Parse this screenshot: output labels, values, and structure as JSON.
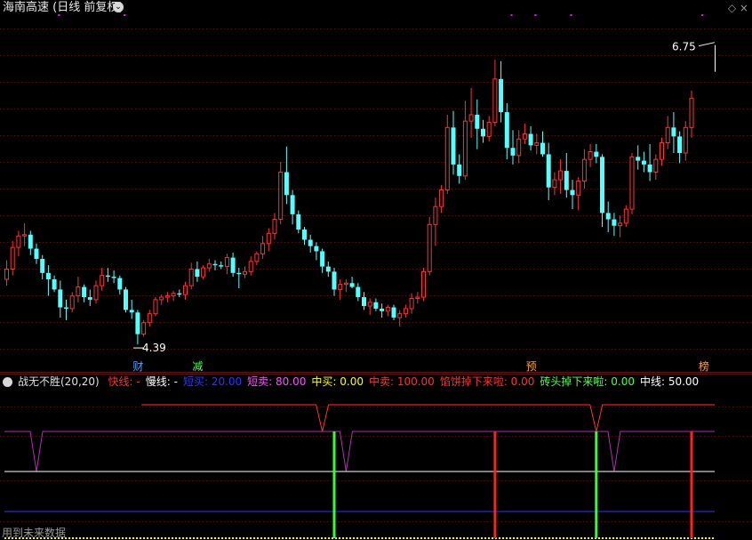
{
  "header": {
    "title": "海南高速 (日线 前复权)",
    "window_controls": "◇ ×"
  },
  "chart_data": [
    {
      "type": "candlestick",
      "title": "海南高速 (日线 前复权)",
      "colors": {
        "up": "#ff3232",
        "down": "#54ffff",
        "flat": "#ffffff",
        "grid": "#7a0000",
        "background": "#000000"
      },
      "ylim": [
        4.3,
        6.95
      ],
      "grid": true,
      "annotations": [
        {
          "text": "6.75",
          "price": 6.75,
          "kind": "high-marker"
        },
        {
          "text": "4.39",
          "price": 4.39,
          "kind": "low-marker"
        }
      ],
      "event_labels": [
        {
          "text": "财",
          "index": 22,
          "color": "#54a0ff"
        },
        {
          "text": "减",
          "index": 32,
          "color": "#50ff50"
        },
        {
          "text": "预",
          "index": 88,
          "color": "#ffa040"
        },
        {
          "text": "榜",
          "index": 117,
          "color": "#ffa040"
        }
      ],
      "top_markers": [
        {
          "index": 9
        },
        {
          "index": 20
        },
        {
          "index": 85
        },
        {
          "index": 89
        },
        {
          "index": 95
        },
        {
          "index": 117
        }
      ],
      "candles": [
        [
          4.9,
          5.05,
          4.85,
          4.98
        ],
        [
          4.98,
          5.2,
          4.93,
          5.15
        ],
        [
          5.15,
          5.28,
          5.08,
          5.24
        ],
        [
          5.24,
          5.34,
          5.16,
          5.25
        ],
        [
          5.25,
          5.28,
          5.09,
          5.14
        ],
        [
          5.14,
          5.18,
          5.02,
          5.06
        ],
        [
          5.06,
          5.09,
          4.9,
          4.95
        ],
        [
          4.95,
          5.01,
          4.77,
          4.9
        ],
        [
          4.9,
          4.93,
          4.8,
          4.82
        ],
        [
          4.82,
          4.89,
          4.6,
          4.68
        ],
        [
          4.68,
          4.74,
          4.58,
          4.67
        ],
        [
          4.67,
          4.8,
          4.64,
          4.77
        ],
        [
          4.77,
          4.92,
          4.72,
          4.84
        ],
        [
          4.84,
          4.86,
          4.72,
          4.76
        ],
        [
          4.76,
          4.82,
          4.69,
          4.74
        ],
        [
          4.74,
          4.89,
          4.71,
          4.85
        ],
        [
          4.85,
          4.99,
          4.81,
          4.93
        ],
        [
          4.93,
          4.99,
          4.88,
          4.92
        ],
        [
          4.92,
          4.97,
          4.87,
          4.91
        ],
        [
          4.91,
          4.93,
          4.78,
          4.82
        ],
        [
          4.82,
          4.84,
          4.64,
          4.66
        ],
        [
          4.66,
          4.74,
          4.59,
          4.64
        ],
        [
          4.64,
          4.66,
          4.39,
          4.47
        ],
        [
          4.47,
          4.58,
          4.45,
          4.56
        ],
        [
          4.56,
          4.66,
          4.53,
          4.63
        ],
        [
          4.63,
          4.76,
          4.61,
          4.74
        ],
        [
          4.74,
          4.78,
          4.7,
          4.76
        ],
        [
          4.76,
          4.8,
          4.72,
          4.77
        ],
        [
          4.77,
          4.81,
          4.73,
          4.79
        ],
        [
          4.79,
          4.82,
          4.76,
          4.78
        ],
        [
          4.78,
          4.88,
          4.74,
          4.85
        ],
        [
          4.85,
          5.03,
          4.82,
          4.98
        ],
        [
          4.98,
          5.04,
          4.88,
          4.92
        ],
        [
          4.92,
          5.01,
          4.9,
          4.99
        ],
        [
          4.99,
          5.06,
          4.96,
          5.02
        ],
        [
          5.02,
          5.05,
          4.97,
          5.01
        ],
        [
          5.01,
          5.04,
          4.98,
          5.0
        ],
        [
          5.0,
          5.1,
          4.94,
          5.07
        ],
        [
          5.07,
          5.11,
          4.92,
          4.95
        ],
        [
          4.95,
          4.99,
          4.83,
          4.94
        ],
        [
          4.94,
          5.0,
          4.91,
          4.96
        ],
        [
          4.96,
          5.08,
          4.93,
          5.04
        ],
        [
          5.04,
          5.12,
          5.01,
          5.1
        ],
        [
          5.1,
          5.24,
          5.06,
          5.18
        ],
        [
          5.18,
          5.3,
          5.12,
          5.26
        ],
        [
          5.26,
          5.42,
          5.21,
          5.37
        ],
        [
          5.37,
          5.82,
          5.33,
          5.74
        ],
        [
          5.74,
          5.94,
          5.49,
          5.56
        ],
        [
          5.56,
          5.6,
          5.33,
          5.41
        ],
        [
          5.41,
          5.44,
          5.26,
          5.29
        ],
        [
          5.29,
          5.31,
          5.17,
          5.21
        ],
        [
          5.21,
          5.25,
          5.11,
          5.16
        ],
        [
          5.16,
          5.19,
          5.05,
          5.12
        ],
        [
          5.12,
          5.14,
          4.95,
          5.0
        ],
        [
          5.0,
          5.04,
          4.92,
          4.96
        ],
        [
          4.96,
          4.99,
          4.77,
          4.82
        ],
        [
          4.82,
          4.9,
          4.74,
          4.86
        ],
        [
          4.86,
          4.9,
          4.8,
          4.87
        ],
        [
          4.87,
          4.92,
          4.83,
          4.84
        ],
        [
          4.84,
          4.87,
          4.73,
          4.76
        ],
        [
          4.76,
          4.8,
          4.66,
          4.69
        ],
        [
          4.69,
          4.75,
          4.62,
          4.72
        ],
        [
          4.72,
          4.75,
          4.65,
          4.67
        ],
        [
          4.67,
          4.71,
          4.6,
          4.65
        ],
        [
          4.65,
          4.7,
          4.61,
          4.68
        ],
        [
          4.68,
          4.7,
          4.58,
          4.6
        ],
        [
          4.6,
          4.66,
          4.53,
          4.63
        ],
        [
          4.63,
          4.7,
          4.6,
          4.67
        ],
        [
          4.67,
          4.79,
          4.63,
          4.75
        ],
        [
          4.75,
          4.8,
          4.71,
          4.76
        ],
        [
          4.76,
          4.99,
          4.73,
          4.96
        ],
        [
          4.96,
          5.39,
          4.93,
          5.33
        ],
        [
          5.33,
          5.54,
          5.16,
          5.47
        ],
        [
          5.47,
          5.64,
          5.42,
          5.6
        ],
        [
          5.6,
          6.19,
          5.57,
          6.09
        ],
        [
          6.09,
          6.22,
          5.72,
          5.8
        ],
        [
          5.8,
          5.88,
          5.65,
          5.71
        ],
        [
          5.71,
          6.3,
          5.68,
          6.14
        ],
        [
          6.14,
          6.4,
          6.01,
          6.19
        ],
        [
          6.19,
          6.31,
          5.92,
          6.08
        ],
        [
          6.08,
          6.15,
          5.97,
          6.02
        ],
        [
          6.02,
          6.18,
          5.98,
          6.13
        ],
        [
          6.13,
          6.62,
          6.1,
          6.47
        ],
        [
          6.47,
          6.61,
          6.13,
          6.21
        ],
        [
          6.21,
          6.28,
          5.84,
          5.93
        ],
        [
          5.93,
          6.07,
          5.8,
          5.87
        ],
        [
          5.87,
          6.07,
          5.81,
          6.0
        ],
        [
          6.0,
          6.12,
          5.96,
          6.04
        ],
        [
          6.04,
          6.1,
          5.91,
          5.95
        ],
        [
          5.95,
          6.04,
          5.88,
          5.97
        ],
        [
          5.97,
          6.06,
          5.86,
          5.88
        ],
        [
          5.88,
          5.97,
          5.52,
          5.62
        ],
        [
          5.62,
          5.74,
          5.56,
          5.68
        ],
        [
          5.68,
          5.84,
          5.57,
          5.75
        ],
        [
          5.75,
          5.89,
          5.54,
          5.6
        ],
        [
          5.6,
          5.68,
          5.45,
          5.56
        ],
        [
          5.56,
          5.7,
          5.44,
          5.67
        ],
        [
          5.67,
          5.92,
          5.61,
          5.84
        ],
        [
          5.84,
          5.96,
          5.78,
          5.9
        ],
        [
          5.9,
          5.96,
          5.81,
          5.86
        ],
        [
          5.86,
          5.88,
          5.31,
          5.42
        ],
        [
          5.42,
          5.51,
          5.27,
          5.37
        ],
        [
          5.37,
          5.42,
          5.24,
          5.32
        ],
        [
          5.32,
          5.4,
          5.23,
          5.34
        ],
        [
          5.34,
          5.48,
          5.31,
          5.45
        ],
        [
          5.45,
          5.89,
          5.41,
          5.86
        ],
        [
          5.86,
          5.95,
          5.76,
          5.83
        ],
        [
          5.83,
          5.9,
          5.74,
          5.8
        ],
        [
          5.8,
          5.96,
          5.67,
          5.74
        ],
        [
          5.74,
          5.88,
          5.68,
          5.84
        ],
        [
          5.84,
          6.01,
          5.79,
          5.97
        ],
        [
          5.97,
          6.18,
          5.92,
          6.09
        ],
        [
          6.09,
          6.21,
          5.89,
          6.02
        ],
        [
          6.02,
          6.06,
          5.81,
          5.89
        ],
        [
          5.89,
          6.14,
          5.83,
          6.09
        ],
        [
          6.09,
          6.38,
          6.01,
          6.32
        ]
      ]
    },
    {
      "type": "line",
      "title": "战无不胜(20,20)",
      "ylim": [
        0,
        110
      ],
      "legend": [
        {
          "label": "快线: -",
          "color": "#ff3232"
        },
        {
          "label": "慢线: -",
          "color": "#ffffff"
        },
        {
          "label": "短买: 20.00",
          "color": "#3232ff"
        },
        {
          "label": "短卖: 80.00",
          "color": "#ff50ff"
        },
        {
          "label": "中买: 0.00",
          "color": "#ffff00"
        },
        {
          "label": "中卖: 100.00",
          "color": "#ff3232"
        },
        {
          "label": "馅饼掉下来啦: 0.00",
          "color": "#ff3232"
        },
        {
          "label": "砖头掉下来啦: 0.00",
          "color": "#50ff50"
        },
        {
          "label": "中线: 50.00",
          "color": "#ffffff"
        }
      ],
      "horizontal_lines": [
        {
          "name": "中卖",
          "value": 100,
          "color": "#ff3232",
          "segment_start_index": 23
        },
        {
          "name": "短卖",
          "value": 80,
          "color": "#b030b0"
        },
        {
          "name": "中线",
          "value": 50,
          "color": "#ffffff"
        },
        {
          "name": "短买",
          "value": 20,
          "color": "#3232ff"
        },
        {
          "name": "中买",
          "value": 0,
          "color": "#ffff00",
          "style": "dotted"
        }
      ],
      "dips": [
        {
          "index": 5,
          "to": 50,
          "line": "短卖"
        },
        {
          "index": 57,
          "to": 50,
          "line": "短卖"
        },
        {
          "index": 53,
          "to": 80,
          "line": "中卖"
        },
        {
          "index": 102,
          "to": 50,
          "line": "短卖"
        },
        {
          "index": 99,
          "to": 80,
          "line": "中卖"
        }
      ],
      "signals": [
        {
          "name": "砖头掉下来啦",
          "index": 55,
          "color": "#32ff32",
          "from": 0,
          "to": 80
        },
        {
          "name": "馅饼掉下来啦",
          "index": 82,
          "color": "#ff2020",
          "from": 0,
          "to": 80
        },
        {
          "name": "砖头掉下来啦",
          "index": 99,
          "color": "#32ff32",
          "from": 0,
          "to": 80
        },
        {
          "name": "馅饼掉下来啦",
          "index": 115,
          "color": "#ff2020",
          "from": 0,
          "to": 80
        }
      ]
    }
  ],
  "footer": {
    "note": "用到未来数据"
  }
}
